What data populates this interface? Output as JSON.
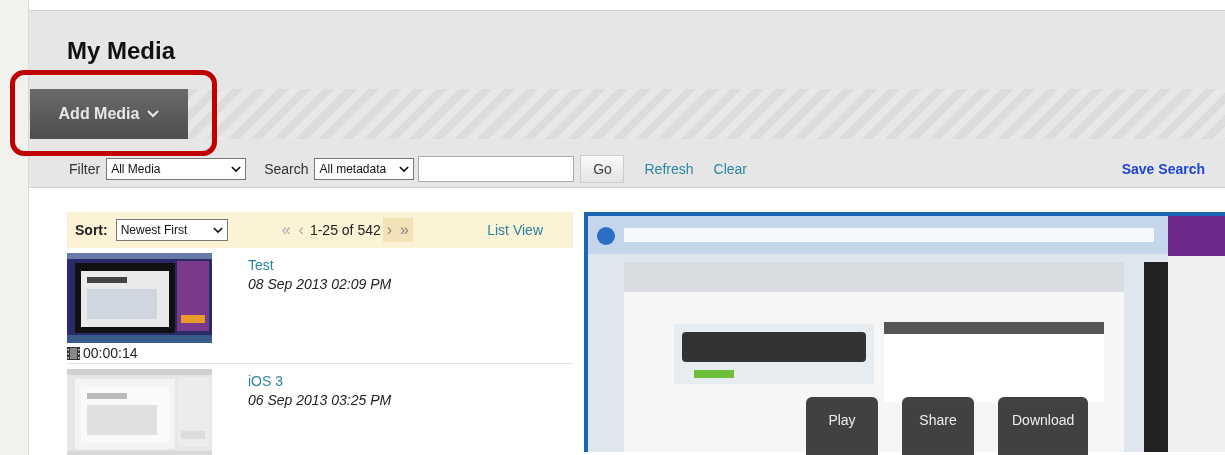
{
  "page": {
    "title": "My Media",
    "highlight_add_media": true
  },
  "add_media": {
    "label": "Add Media"
  },
  "filter_bar": {
    "filter_label": "Filter",
    "filter_value": "All Media",
    "search_label": "Search",
    "search_scope": "All metadata",
    "go": "Go",
    "links": [
      "Refresh",
      "Clear"
    ],
    "save_search": "Save Search"
  },
  "list": {
    "sort_label": "Sort:",
    "sort_value": "Newest First",
    "pager": {
      "before": [
        {
          "glyph": "«",
          "disabled": true
        },
        {
          "glyph": "‹",
          "disabled": true
        }
      ],
      "range": "1-25 of 542",
      "after": [
        {
          "glyph": "›",
          "disabled": false
        },
        {
          "glyph": "»",
          "disabled": false
        }
      ]
    },
    "view_link": "List View",
    "items": [
      {
        "title": "Test",
        "date": "08 Sep 2013 02:09 PM",
        "duration": "00:00:14"
      },
      {
        "title": "iOS 3",
        "date": "06 Sep 2013 03:25 PM"
      }
    ]
  },
  "preview": {
    "actions": [
      "Play",
      "Share",
      "Download"
    ]
  }
}
